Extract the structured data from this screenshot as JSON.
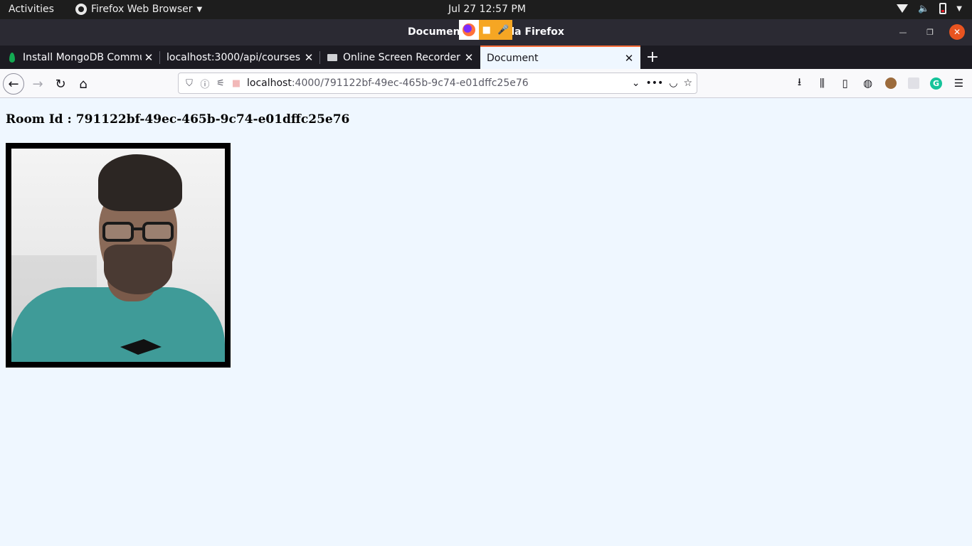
{
  "topbar": {
    "activities": "Activities",
    "app_menu": "Firefox Web Browser",
    "datetime": "Jul 27  12:57 PM"
  },
  "window": {
    "title": "Document — Mozilla Firefox"
  },
  "tabs": [
    {
      "label": "Install MongoDB Community",
      "icon": "mongodb-leaf-icon",
      "active": false
    },
    {
      "label": "localhost:3000/api/courses",
      "icon": "",
      "active": false
    },
    {
      "label": "Online Screen Recorder",
      "icon": "monitor-icon",
      "active": true
    },
    {
      "label": "Document",
      "icon": "",
      "active": true
    }
  ],
  "navbar": {
    "url_host": "localhost",
    "url_rest": ":4000/791122bf-49ec-465b-9c74-e01dffc25e76"
  },
  "page": {
    "room_label": "Room Id :",
    "room_id": "791122bf-49ec-465b-9c74-e01dffc25e76"
  },
  "colors": {
    "accent_tab": "#ff6c37",
    "page_bg": "#eff7ff",
    "close_button": "#e95420",
    "recorder_overlay": "#f6a623"
  }
}
